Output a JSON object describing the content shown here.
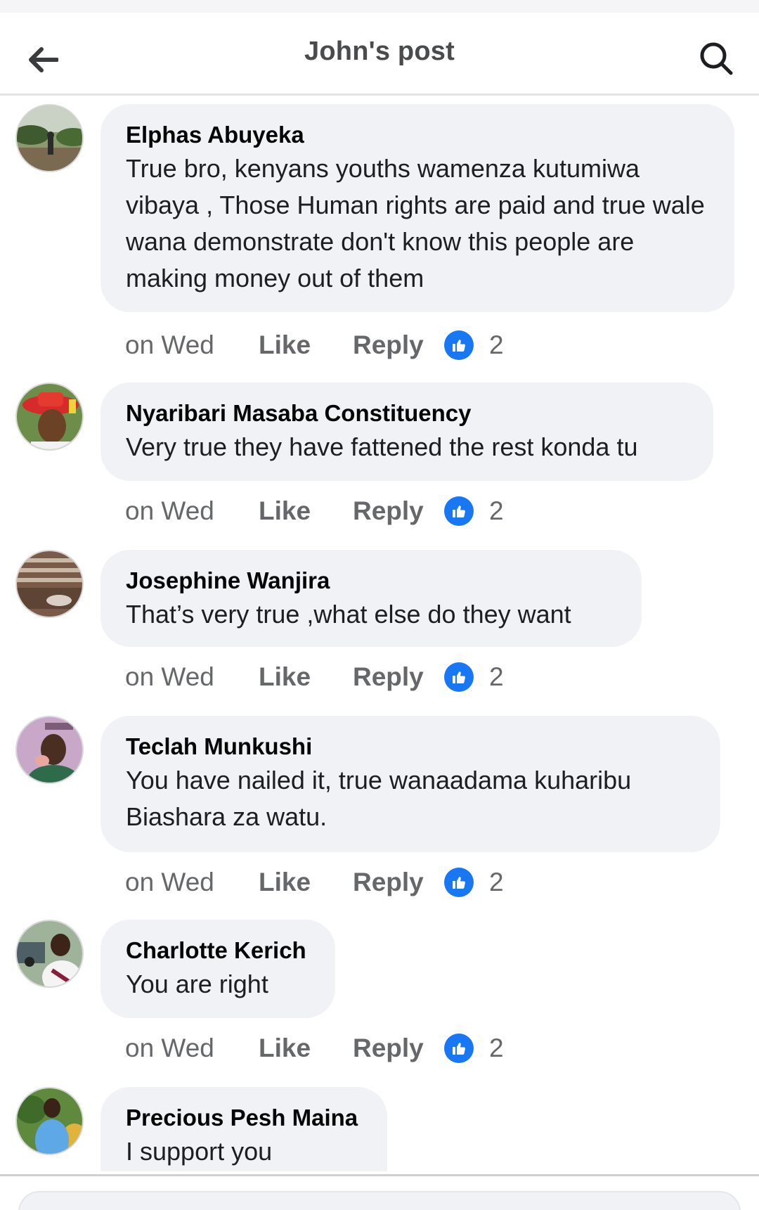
{
  "header": {
    "title": "John's post"
  },
  "comments": [
    {
      "author": "Elphas Abuyeka",
      "text": "True bro, kenyans youths wamenza kutumiwa vibaya , Those Human rights are paid and true wale wana demonstrate don't know this people are making money out of them",
      "time": "on Wed",
      "like_label": "Like",
      "reply_label": "Reply",
      "reaction_count": "2"
    },
    {
      "author": "Nyaribari Masaba Constituency",
      "text": "Very true they have fattened the rest konda tu",
      "time": "on Wed",
      "like_label": "Like",
      "reply_label": "Reply",
      "reaction_count": "2"
    },
    {
      "author": "Josephine Wanjira",
      "text": "That’s very true ,what else do they want",
      "time": "on Wed",
      "like_label": "Like",
      "reply_label": "Reply",
      "reaction_count": "2"
    },
    {
      "author": "Teclah Munkushi",
      "text": "You have nailed it, true wanaadama  kuharibu Biashara za watu.",
      "time": "on Wed",
      "like_label": "Like",
      "reply_label": "Reply",
      "reaction_count": "2"
    },
    {
      "author": "Charlotte Kerich",
      "text": "You are right",
      "time": "on Wed",
      "like_label": "Like",
      "reply_label": "Reply",
      "reaction_count": "2"
    },
    {
      "author": "Precious Pesh Maina",
      "text": "I support you"
    }
  ],
  "icons": {
    "back": "arrow-left-icon",
    "search": "search-icon",
    "reaction": "like-reaction-icon"
  },
  "colors": {
    "bubble": "#f0f2f5",
    "secondary_text": "#65676b",
    "like_blue": "#1877f2"
  }
}
